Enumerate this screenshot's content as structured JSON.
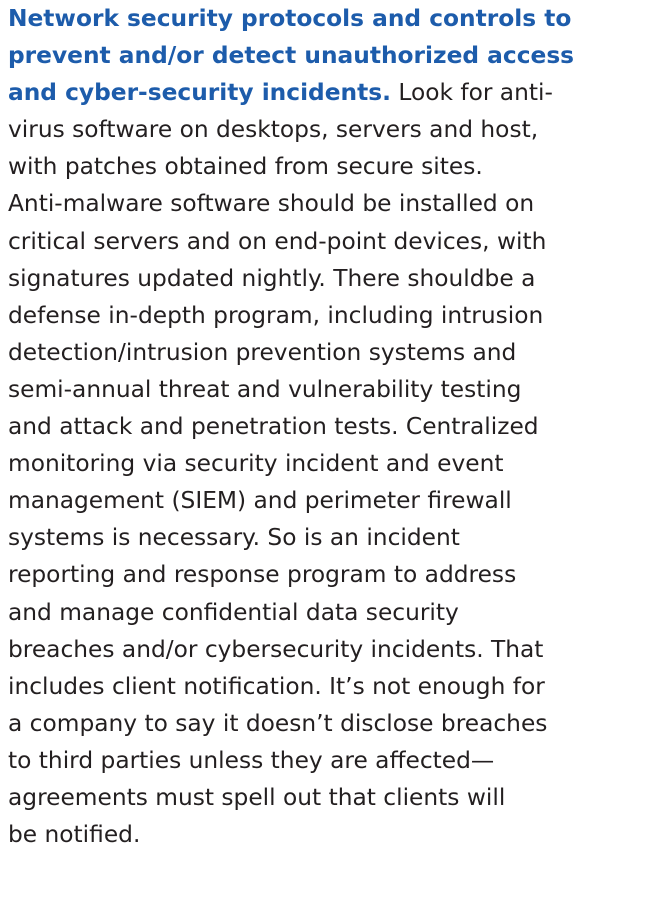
{
  "document": {
    "lead_lines": [
      "Network security protocols and controls to",
      "prevent and/or detect unauthorized access",
      "and cyber-security incidents."
    ],
    "body_first_fragment": " Look for anti-",
    "body_lines": [
      "virus software on desktops, servers and host,",
      "with patches obtained from secure sites.",
      "Anti-malware software should be installed on",
      "critical servers and on end-point devices, with",
      "signatures updated nightly. There shouldbe a",
      "defense in-depth program, including intrusion",
      "detection/intrusion prevention systems and",
      "semi-annual threat and vulnerability testing",
      "and attack and penetration tests. Centralized",
      "monitoring via security incident and event",
      "management (SIEM) and perimeter firewall",
      "systems is necessary. So is an incident",
      "reporting and response program to address",
      "and manage confidential data security",
      "breaches and/or cybersecurity incidents. That",
      "includes client notification. It’s not enough for",
      "a company to say it doesn’t disclose breaches",
      "to third parties unless they are affected—",
      "agreements must spell out that clients will",
      "be notified."
    ],
    "colors": {
      "lead": "#1d5cab",
      "body": "#231f20"
    }
  }
}
